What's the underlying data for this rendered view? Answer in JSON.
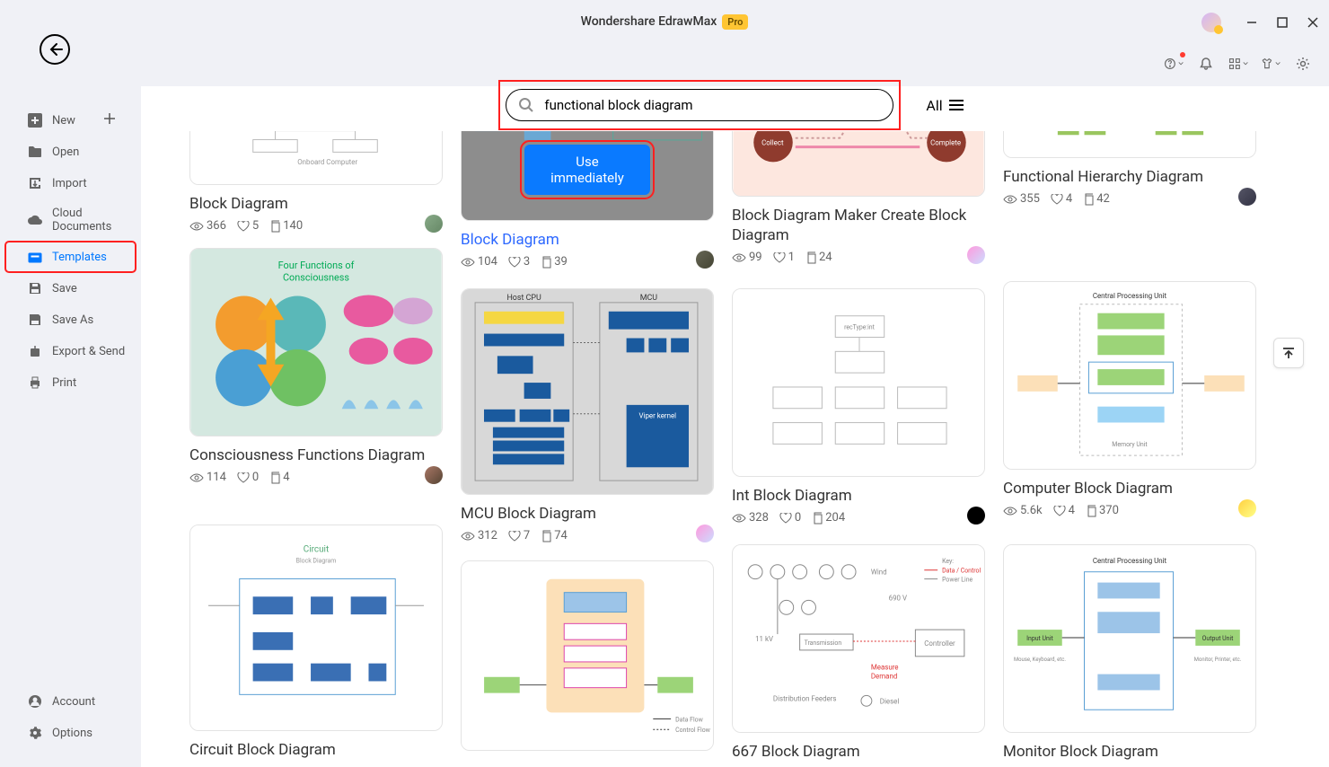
{
  "app": {
    "title": "Wondershare EdrawMax",
    "badge": "Pro"
  },
  "sidebar": {
    "new": "New",
    "open": "Open",
    "import": "Import",
    "cloud": "Cloud Documents",
    "templates": "Templates",
    "save": "Save",
    "saveas": "Save As",
    "export": "Export & Send",
    "print": "Print",
    "account": "Account",
    "options": "Options"
  },
  "search": {
    "value": "functional block diagram",
    "all": "All"
  },
  "use_btn": "Use immediately",
  "cards": {
    "c1": {
      "title": "Block Diagram",
      "views": "366",
      "likes": "5",
      "copies": "140"
    },
    "c2": {
      "title": "Block Diagram",
      "views": "104",
      "likes": "3",
      "copies": "39"
    },
    "c3": {
      "title": "Block Diagram Maker Create Block Diagram",
      "views": "99",
      "likes": "1",
      "copies": "24"
    },
    "c4": {
      "title": "Functional Hierarchy Diagram",
      "views": "355",
      "likes": "4",
      "copies": "42"
    },
    "c5": {
      "title": "Consciousness Functions Diagram",
      "views": "114",
      "likes": "0",
      "copies": "4"
    },
    "c6": {
      "title": "MCU Block Diagram",
      "views": "312",
      "likes": "7",
      "copies": "74"
    },
    "c7": {
      "title": "Int Block Diagram",
      "views": "328",
      "likes": "0",
      "copies": "204"
    },
    "c8": {
      "title": "Computer Block Diagram",
      "views": "5.6k",
      "likes": "4",
      "copies": "370"
    },
    "c9": {
      "title": "Circuit Block Diagram"
    },
    "c10": {
      "title": ""
    },
    "c11": {
      "title": "667 Block Diagram"
    },
    "c12": {
      "title": "Monitor Block Diagram"
    }
  }
}
